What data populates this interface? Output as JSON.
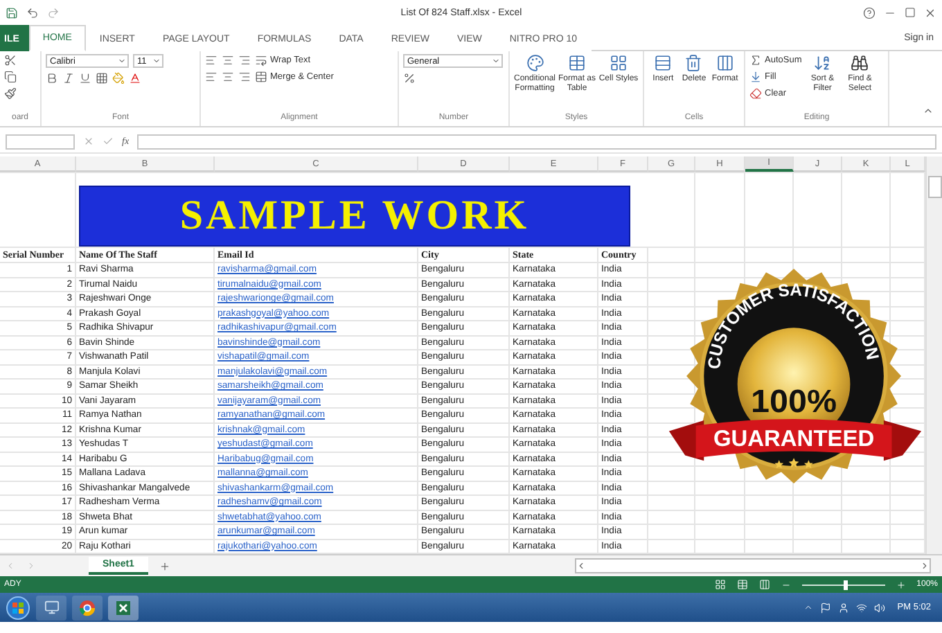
{
  "title_bar": {
    "title": "List Of 824 Staff.xlsx - Excel"
  },
  "ribbon_tabs": [
    {
      "label": "ILE",
      "kind": "file",
      "selected": false
    },
    {
      "label": "HOME",
      "kind": "tab",
      "selected": true
    },
    {
      "label": "INSERT",
      "kind": "tab",
      "selected": false
    },
    {
      "label": "PAGE LAYOUT",
      "kind": "tab",
      "selected": false
    },
    {
      "label": "FORMULAS",
      "kind": "tab",
      "selected": false
    },
    {
      "label": "DATA",
      "kind": "tab",
      "selected": false
    },
    {
      "label": "REVIEW",
      "kind": "tab",
      "selected": false
    },
    {
      "label": "VIEW",
      "kind": "tab",
      "selected": false
    },
    {
      "label": "NITRO PRO 10",
      "kind": "tab",
      "selected": false
    }
  ],
  "sign_in": "Sign in",
  "ribbon": {
    "font": {
      "name": "Calibri",
      "size": "11"
    },
    "alignment": {
      "wrap_text": "Wrap Text",
      "merge": "Merge & Center"
    },
    "number": {
      "format": "General"
    },
    "styles": [
      "Conditional Formatting",
      "Format as Table",
      "Cell Styles"
    ],
    "cells": [
      "Insert",
      "Delete",
      "Format"
    ],
    "editing": {
      "autosum": "AutoSum",
      "fill": "Fill",
      "clear": "Clear",
      "sort": "Sort & Filter",
      "find": "Find & Select"
    },
    "group_labels": [
      "oard",
      "Font",
      "Alignment",
      "Number",
      "Styles",
      "Cells",
      "Editing"
    ]
  },
  "formula_bar": {
    "fx": "fx"
  },
  "columns": [
    {
      "label": "A",
      "selected": false
    },
    {
      "label": "B",
      "selected": false
    },
    {
      "label": "C",
      "selected": false
    },
    {
      "label": "D",
      "selected": false
    },
    {
      "label": "E",
      "selected": false
    },
    {
      "label": "F",
      "selected": false
    },
    {
      "label": "G",
      "selected": false
    },
    {
      "label": "H",
      "selected": false
    },
    {
      "label": "I",
      "selected": true
    },
    {
      "label": "J",
      "selected": false
    },
    {
      "label": "K",
      "selected": false
    },
    {
      "label": "L",
      "selected": false
    }
  ],
  "banner": "SAMPLE WORK",
  "table_header": [
    "Serial Number",
    "Name Of The Staff",
    "Email Id",
    "City",
    "State",
    "Country"
  ],
  "rows": [
    {
      "serial": "1",
      "name": "Ravi Sharma",
      "email": "ravisharma@gmail.com",
      "city": "Bengaluru",
      "state": "Karnataka",
      "country": "India"
    },
    {
      "serial": "2",
      "name": "Tirumal Naidu",
      "email": "tirumalnaidu@gmail.com",
      "city": "Bengaluru",
      "state": "Karnataka",
      "country": "India"
    },
    {
      "serial": "3",
      "name": "Rajeshwari Onge",
      "email": "rajeshwarionge@gmail.com",
      "city": "Bengaluru",
      "state": "Karnataka",
      "country": "India"
    },
    {
      "serial": "4",
      "name": "Prakash Goyal",
      "email": "prakashgoyal@yahoo.com",
      "city": "Bengaluru",
      "state": "Karnataka",
      "country": "India"
    },
    {
      "serial": "5",
      "name": "Radhika Shivapur",
      "email": "radhikashivapur@gmail.com",
      "city": "Bengaluru",
      "state": "Karnataka",
      "country": "India"
    },
    {
      "serial": "6",
      "name": "Bavin Shinde",
      "email": "bavinshinde@gmail.com",
      "city": "Bengaluru",
      "state": "Karnataka",
      "country": "India"
    },
    {
      "serial": "7",
      "name": "Vishwanath Patil",
      "email": "vishapatil@gmail.com",
      "city": "Bengaluru",
      "state": "Karnataka",
      "country": "India"
    },
    {
      "serial": "8",
      "name": "Manjula Kolavi",
      "email": "manjulakolavi@gmail.com",
      "city": "Bengaluru",
      "state": "Karnataka",
      "country": "India"
    },
    {
      "serial": "9",
      "name": "Samar Sheikh",
      "email": "samarsheikh@gmail.com",
      "city": "Bengaluru",
      "state": "Karnataka",
      "country": "India"
    },
    {
      "serial": "10",
      "name": "Vani Jayaram",
      "email": "vanijayaram@gmail.com",
      "city": "Bengaluru",
      "state": "Karnataka",
      "country": "India"
    },
    {
      "serial": "11",
      "name": "Ramya Nathan",
      "email": "ramyanathan@gmail.com",
      "city": "Bengaluru",
      "state": "Karnataka",
      "country": "India"
    },
    {
      "serial": "12",
      "name": "Krishna Kumar",
      "email": "krishnak@gmail.com",
      "city": "Bengaluru",
      "state": "Karnataka",
      "country": "India"
    },
    {
      "serial": "13",
      "name": "Yeshudas T",
      "email": "yeshudast@gmail.com",
      "city": "Bengaluru",
      "state": "Karnataka",
      "country": "India"
    },
    {
      "serial": "14",
      "name": "Haribabu G",
      "email": "Haribabug@gmail.com",
      "city": "Bengaluru",
      "state": "Karnataka",
      "country": "India"
    },
    {
      "serial": "15",
      "name": "Mallana Ladava",
      "email": "mallanna@gmail.com",
      "city": "Bengaluru",
      "state": "Karnataka",
      "country": "India"
    },
    {
      "serial": "16",
      "name": "Shivashankar Mangalvede",
      "email": "shivashankarm@gmail.com",
      "city": "Bengaluru",
      "state": "Karnataka",
      "country": "India"
    },
    {
      "serial": "17",
      "name": "Radhesham Verma",
      "email": "radheshamv@gmail.com",
      "city": "Bengaluru",
      "state": "Karnataka",
      "country": "India"
    },
    {
      "serial": "18",
      "name": "Shweta Bhat",
      "email": "shwetabhat@yahoo.com",
      "city": "Bengaluru",
      "state": "Karnataka",
      "country": "India"
    },
    {
      "serial": "19",
      "name": "Arun kumar",
      "email": "arunkumar@gmail.com",
      "city": "Bengaluru",
      "state": "Karnataka",
      "country": "India"
    },
    {
      "serial": "20",
      "name": "Raju Kothari",
      "email": "rajukothari@yahoo.com",
      "city": "Bengaluru",
      "state": "Karnataka",
      "country": "India"
    }
  ],
  "badge": {
    "arc_text": "CUSTOMER SATISFACTION",
    "center_text": "100%",
    "ribbon_text": "GUARANTEED"
  },
  "sheet_tabs": [
    {
      "label": "Sheet1",
      "selected": true
    }
  ],
  "status_bar": {
    "mode": "ADY",
    "zoom": {
      "level": 0.5
    },
    "zoom_text": "100%"
  },
  "taskbar": {
    "clock": "PM 5:02"
  }
}
